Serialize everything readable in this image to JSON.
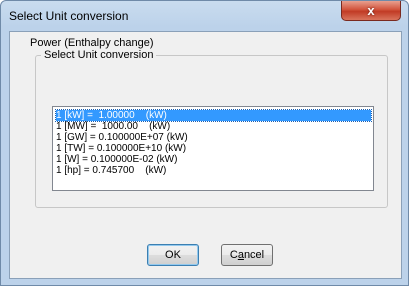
{
  "window": {
    "title": "Select Unit conversion",
    "close_glyph": "x"
  },
  "dialog": {
    "power_label": "Power (Enthalpy change)",
    "group_title": "Select Unit conversion",
    "conversions": [
      "1 [kW] =  1.00000    (kW)",
      "1 [MW] =  1000.00    (kW)",
      "1 [GW] = 0.100000E+07 (kW)",
      "1 [TW] = 0.100000E+10 (kW)",
      "1 [W] = 0.100000E-02 (kW)",
      "1 [hp] = 0.745700    (kW)"
    ],
    "selected_index": 0
  },
  "buttons": {
    "ok_label": "OK",
    "cancel_prefix": "C",
    "cancel_mnemonic": "a",
    "cancel_suffix": "ncel"
  }
}
